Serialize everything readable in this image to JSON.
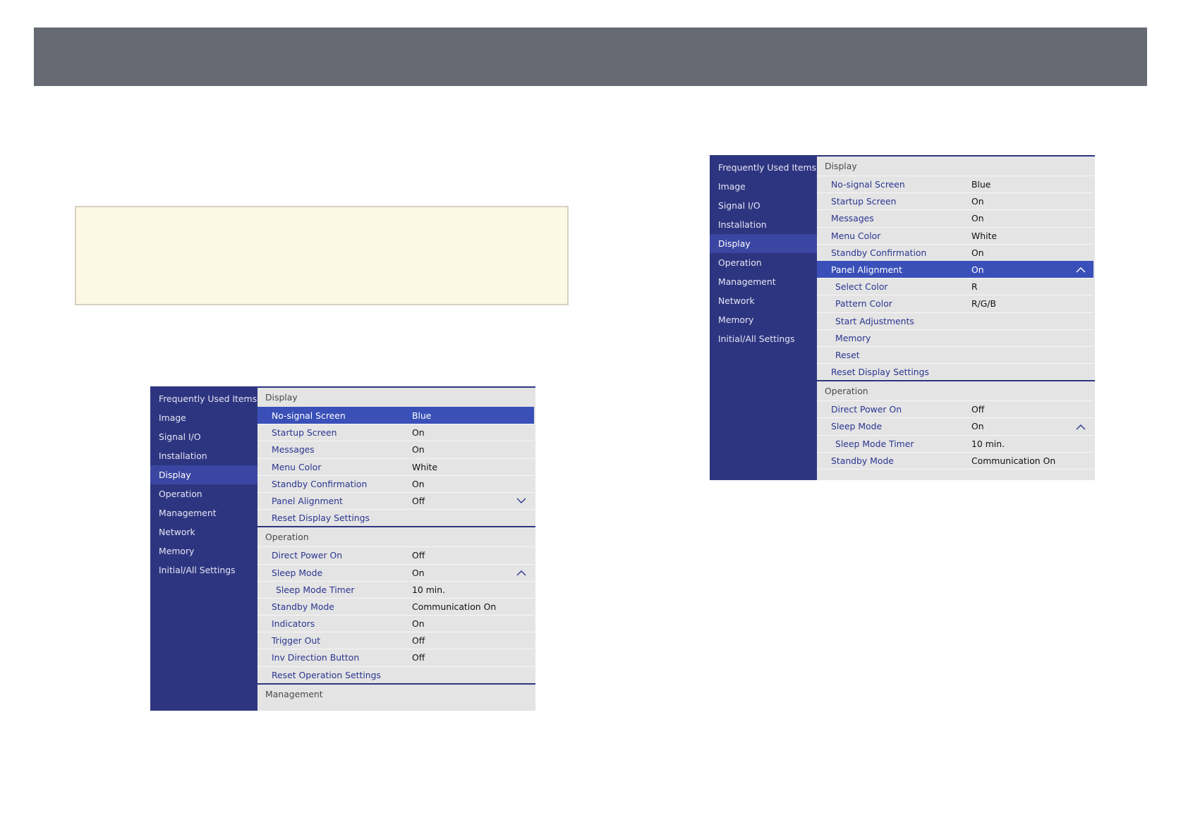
{
  "menu1": {
    "sidebar": [
      {
        "label": "Frequently Used Items"
      },
      {
        "label": "Image"
      },
      {
        "label": "Signal I/O"
      },
      {
        "label": "Installation"
      },
      {
        "label": "Display",
        "active": true
      },
      {
        "label": "Operation"
      },
      {
        "label": "Management"
      },
      {
        "label": "Network"
      },
      {
        "label": "Memory"
      },
      {
        "label": "Initial/All Settings"
      }
    ],
    "sections": [
      {
        "title": "Display",
        "rows": [
          {
            "label": "No-signal Screen",
            "value": "Blue",
            "selected": true
          },
          {
            "label": "Startup Screen",
            "value": "On"
          },
          {
            "label": "Messages",
            "value": "On"
          },
          {
            "label": "Menu Color",
            "value": "White"
          },
          {
            "label": "Standby Confirmation",
            "value": "On"
          },
          {
            "label": "Panel Alignment",
            "value": "Off",
            "chevron": "down"
          },
          {
            "label": "Reset Display Settings"
          }
        ]
      },
      {
        "title": "Operation",
        "rows": [
          {
            "label": "Direct Power On",
            "value": "Off"
          },
          {
            "label": "Sleep Mode",
            "value": "On",
            "chevron": "up"
          },
          {
            "label": "Sleep Mode Timer",
            "value": "10 min.",
            "sub": true
          },
          {
            "label": "Standby Mode",
            "value": "Communication On"
          },
          {
            "label": "Indicators",
            "value": "On"
          },
          {
            "label": "Trigger Out",
            "value": "Off"
          },
          {
            "label": "Inv Direction Button",
            "value": "Off"
          },
          {
            "label": "Reset Operation Settings"
          }
        ]
      },
      {
        "title": "Management",
        "rows": []
      }
    ]
  },
  "menu2": {
    "sidebar": [
      {
        "label": "Frequently Used Items"
      },
      {
        "label": "Image"
      },
      {
        "label": "Signal I/O"
      },
      {
        "label": "Installation"
      },
      {
        "label": "Display",
        "active": true
      },
      {
        "label": "Operation"
      },
      {
        "label": "Management"
      },
      {
        "label": "Network"
      },
      {
        "label": "Memory"
      },
      {
        "label": "Initial/All Settings"
      }
    ],
    "sections": [
      {
        "title": "Display",
        "rows": [
          {
            "label": "No-signal Screen",
            "value": "Blue"
          },
          {
            "label": "Startup Screen",
            "value": "On"
          },
          {
            "label": "Messages",
            "value": "On"
          },
          {
            "label": "Menu Color",
            "value": "White"
          },
          {
            "label": "Standby Confirmation",
            "value": "On"
          },
          {
            "label": "Panel Alignment",
            "value": "On",
            "chevron": "up",
            "selected": true
          },
          {
            "label": "Select Color",
            "value": "R",
            "sub": true
          },
          {
            "label": "Pattern Color",
            "value": "R/G/B",
            "sub": true
          },
          {
            "label": "Start Adjustments",
            "sub": true
          },
          {
            "label": "Memory",
            "sub": true
          },
          {
            "label": "Reset",
            "sub": true
          },
          {
            "label": "Reset Display Settings"
          }
        ]
      },
      {
        "title": "Operation",
        "rows": [
          {
            "label": "Direct Power On",
            "value": "Off"
          },
          {
            "label": "Sleep Mode",
            "value": "On",
            "chevron": "up"
          },
          {
            "label": "Sleep Mode Timer",
            "value": "10 min.",
            "sub": true
          },
          {
            "label": "Standby Mode",
            "value": "Communication On"
          },
          {
            "label": "",
            "cut": true
          }
        ]
      }
    ]
  },
  "colors": {
    "sidebar_bg": "#2e3580",
    "sidebar_active": "#3a46a2",
    "panel_bg": "#e4e4e4",
    "selected_row": "#3a50b8",
    "item_text": "#2a3590",
    "note_bg": "#fdf8e4",
    "header_bar": "#676a72"
  }
}
